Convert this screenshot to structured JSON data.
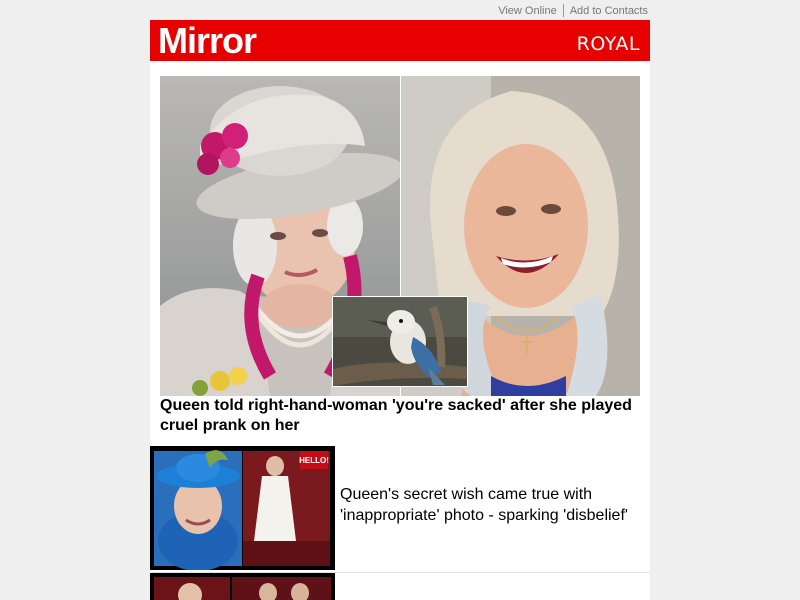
{
  "topbar": {
    "view_online": "View Online",
    "add_to_contacts": "Add to Contacts"
  },
  "header": {
    "logo": "Mirror",
    "section": "ROYAL",
    "brand_color": "#e60000"
  },
  "hero": {
    "headline": "Queen told right-hand-woman 'you're sacked' after she played cruel prank on her",
    "images": [
      "queen-photo",
      "woman-photo",
      "kookaburra-inset-photo"
    ]
  },
  "articles": [
    {
      "title": "Queen's secret wish came true with 'inappropriate' photo - sparking 'disbelief'",
      "thumb_badge": "HELLO!"
    },
    {
      "title": ""
    }
  ]
}
